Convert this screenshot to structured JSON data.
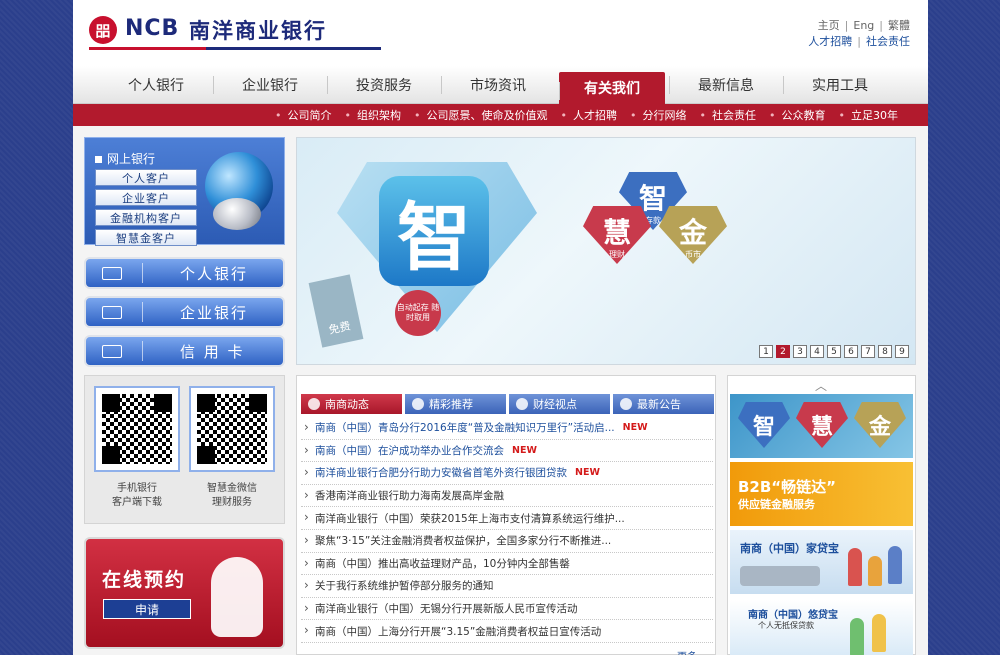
{
  "header": {
    "logo_mark": "㗊",
    "logo_en": "NCB",
    "logo_cn": "南洋商业银行",
    "top_links_row1": [
      "主页",
      "Eng",
      "繁體"
    ],
    "top_links_row2": [
      "人才招聘",
      "社会责任"
    ]
  },
  "main_nav": [
    "个人银行",
    "企业银行",
    "投资服务",
    "市场资讯",
    "有关我们",
    "最新信息",
    "实用工具"
  ],
  "main_nav_active": "有关我们",
  "sub_nav": [
    "公司简介",
    "组织架构",
    "公司愿景、使命及价值观",
    "人才招聘",
    "分行网络",
    "社会责任",
    "公众教育",
    "立足30年"
  ],
  "ebank": {
    "title": "网上银行",
    "buttons": [
      "个人客户",
      "企业客户",
      "金融机构客户",
      "智慧金客户"
    ]
  },
  "bank_buttons": [
    "个人银行",
    "企业银行",
    "信 用 卡"
  ],
  "qr": {
    "left_caption": [
      "手机银行",
      "客户端下载"
    ],
    "right_caption": [
      "智慧金微信",
      "理财服务"
    ]
  },
  "appointment": {
    "title": "在线预约",
    "button": "申请"
  },
  "banner": {
    "big_char": "智",
    "tag_text": "免费",
    "seal_text": "自动起存 随时取用",
    "gems": [
      {
        "char": "智",
        "sub": "存款",
        "color": "#3c6fc0"
      },
      {
        "char": "慧",
        "sub": "理财",
        "color": "#c83a4c"
      },
      {
        "char": "金",
        "sub": "币市",
        "color": "#b7a257"
      }
    ],
    "pages": [
      "1",
      "2",
      "3",
      "4",
      "5",
      "6",
      "7",
      "8",
      "9"
    ],
    "active_page": "2"
  },
  "news": {
    "tabs": [
      "南商动态",
      "精彩推荐",
      "财经视点",
      "最新公告"
    ],
    "active_tab": "南商动态",
    "new_badge": "NEW",
    "items": [
      {
        "text": "南商（中国）青岛分行2016年度“普及金融知识万里行”活动启...",
        "new": true,
        "highlight": true
      },
      {
        "text": "南商（中国）在沪成功举办业合作交流会",
        "new": true,
        "highlight": true
      },
      {
        "text": "南洋商业银行合肥分行助力安徽省首笔外资行银团贷款",
        "new": true,
        "highlight": true
      },
      {
        "text": "香港南洋商业银行助力海南发展高岸金融",
        "new": false,
        "highlight": false
      },
      {
        "text": "南洋商业银行（中国）荣获2015年上海市支付清算系统运行维护...",
        "new": false,
        "highlight": false
      },
      {
        "text": "聚焦“3·15”关注金融消费者权益保护，全国多家分行不断推进...",
        "new": false,
        "highlight": false
      },
      {
        "text": "南商（中国）推出高收益理财产品，10分钟内全部售罄",
        "new": false,
        "highlight": false
      },
      {
        "text": "关于我行系统维护暂停部分服务的通知",
        "new": false,
        "highlight": false
      },
      {
        "text": "南洋商业银行（中国）无锡分行开展新版人民币宣传活动",
        "new": false,
        "highlight": false
      },
      {
        "text": "南商（中国）上海分行开展“3.15”金融消费者权益日宣传活动",
        "new": false,
        "highlight": false
      }
    ],
    "more": "更多"
  },
  "right_promos": {
    "gems": [
      {
        "char": "智",
        "color": "#3c6fc0"
      },
      {
        "char": "慧",
        "color": "#c83a4c"
      },
      {
        "char": "金",
        "color": "#b7a257"
      }
    ],
    "b2b_title": "B2B“畅链达”",
    "b2b_sub": "供应链金融服务",
    "loan_title": "南商（中国）家贷宝",
    "loan4_title": "南商（中国）悠贷宝",
    "loan4_sub": "个人无抵保贷款"
  }
}
